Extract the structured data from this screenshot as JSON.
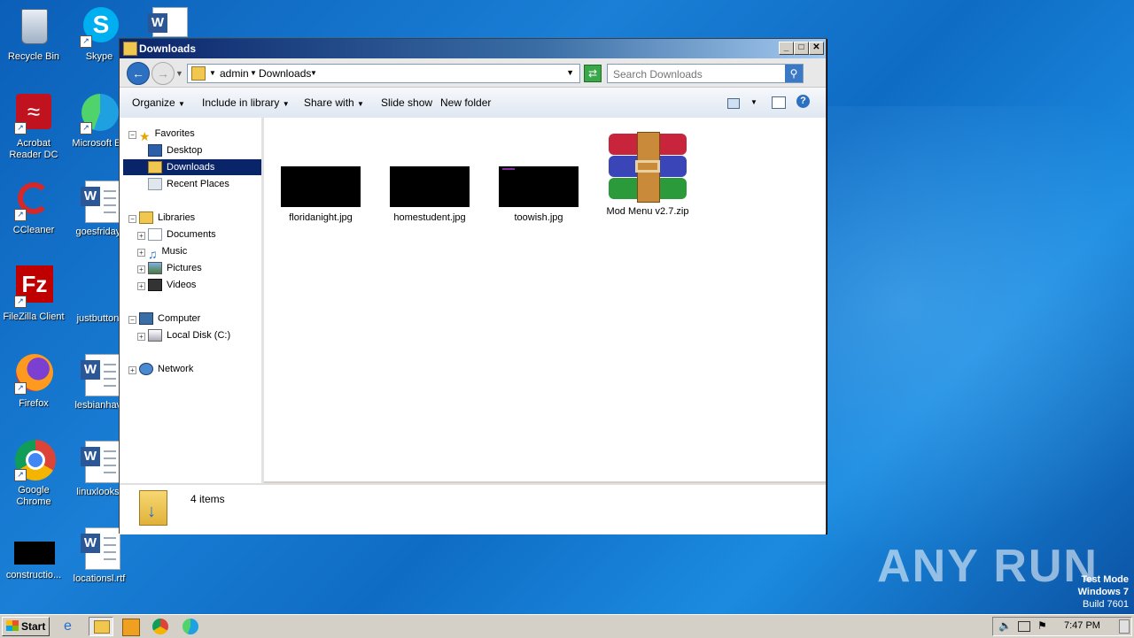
{
  "desktop": {
    "icons": [
      {
        "label": "Recycle Bin"
      },
      {
        "label": "Skype"
      },
      {
        "label": "Acrobat Reader DC"
      },
      {
        "label": "Microsoft Ed"
      },
      {
        "label": "CCleaner"
      },
      {
        "label": "goesfriday."
      },
      {
        "label": "FileZilla Client"
      },
      {
        "label": "justbutton."
      },
      {
        "label": "Firefox"
      },
      {
        "label": "lesbianhavi"
      },
      {
        "label": "Google Chrome"
      },
      {
        "label": "linuxlooks."
      },
      {
        "label": "constructio..."
      },
      {
        "label": "locationsl.rtf"
      }
    ],
    "watermark": "ANY RUN",
    "test_mode": {
      "line1": "Test Mode",
      "line2": "Windows 7",
      "line3": "Build 7601"
    }
  },
  "window": {
    "title": "Downloads",
    "breadcrumb": [
      "admin",
      "Downloads"
    ],
    "search_placeholder": "Search Downloads",
    "toolbar": {
      "organize": "Organize",
      "include": "Include in library",
      "share": "Share with",
      "slideshow": "Slide show",
      "newfolder": "New folder"
    },
    "nav": {
      "favorites": "Favorites",
      "desktop": "Desktop",
      "downloads": "Downloads",
      "recent": "Recent Places",
      "libraries": "Libraries",
      "documents": "Documents",
      "music": "Music",
      "pictures": "Pictures",
      "videos": "Videos",
      "computer": "Computer",
      "localdisk": "Local Disk (C:)",
      "network": "Network"
    },
    "files": [
      {
        "name": "floridanight.jpg"
      },
      {
        "name": "homestudent.jpg"
      },
      {
        "name": "toowish.jpg"
      },
      {
        "name": "Mod Menu v2.7.zip"
      }
    ],
    "status": "4 items"
  },
  "taskbar": {
    "start": "Start",
    "clock": "7:47 PM"
  }
}
